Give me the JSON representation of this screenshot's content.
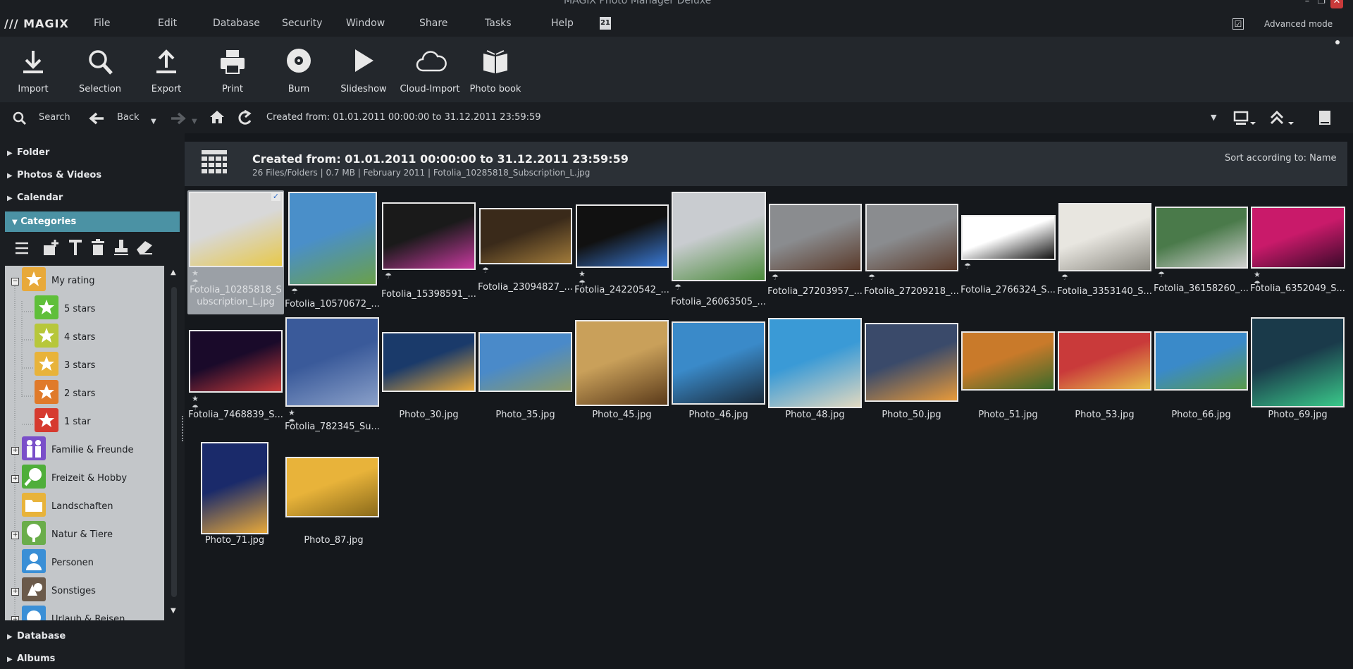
{
  "app": {
    "logo": "/// MAGIX",
    "title": "MAGIX Photo Manager Deluxe"
  },
  "menu": [
    {
      "label": "File"
    },
    {
      "label": "Edit"
    },
    {
      "label": "Database"
    },
    {
      "label": "Security"
    },
    {
      "label": "Window"
    },
    {
      "label": "Share"
    },
    {
      "label": "Tasks"
    },
    {
      "label": "Help"
    }
  ],
  "menu_badge": "21",
  "advanced_mode": {
    "label": "Advanced mode",
    "checked": true,
    "check_glyph": "☑"
  },
  "toolbar": [
    {
      "label": "Import",
      "icon": "download-icon"
    },
    {
      "label": "Selection",
      "icon": "magnifier-icon"
    },
    {
      "label": "Export",
      "icon": "upload-icon"
    },
    {
      "label": "Print",
      "icon": "printer-icon"
    },
    {
      "label": "Burn",
      "icon": "disc-icon"
    },
    {
      "label": "Slideshow",
      "icon": "play-icon"
    },
    {
      "label": "Cloud-Import",
      "icon": "cloud-icon"
    },
    {
      "label": "Photo book",
      "icon": "book-icon"
    }
  ],
  "nav": {
    "search": "Search",
    "back": "Back",
    "created_from": "Created from:  01.01.2011 00:00:00 to  31.12.2011 23:59:59"
  },
  "left": {
    "folder": "Folder",
    "photos_videos": "Photos & Videos",
    "calendar": "Calendar",
    "categories": "Categories",
    "database": "Database",
    "albums": "Albums",
    "tree": [
      {
        "label": "My rating",
        "color": "#e8a93a",
        "level": 0
      },
      {
        "label": "5 stars",
        "color": "#5fbf3a",
        "level": 1
      },
      {
        "label": "4 stars",
        "color": "#b7c73a",
        "level": 1
      },
      {
        "label": "3 stars",
        "color": "#e8b33a",
        "level": 1
      },
      {
        "label": "2 stars",
        "color": "#e07a2a",
        "level": 1
      },
      {
        "label": "1 star",
        "color": "#d63a2f",
        "level": 1
      },
      {
        "label": "Familie & Freunde",
        "color": "#7a4fc9",
        "level": 0
      },
      {
        "label": "Freizeit & Hobby",
        "color": "#4fae3a",
        "level": 0
      },
      {
        "label": "Landschaften",
        "color": "#e8b33a",
        "level": 0
      },
      {
        "label": "Natur & Tiere",
        "color": "#6aad4a",
        "level": 0
      },
      {
        "label": "Personen",
        "color": "#3a8fd6",
        "level": 0
      },
      {
        "label": "Sonstiges",
        "color": "#6b5a4a",
        "level": 0
      },
      {
        "label": "Urlaub & Reisen",
        "color": "#3a8fd6",
        "level": 0
      }
    ]
  },
  "content": {
    "title": "Created from:  01.01.2011 00:00:00 to  31.12.2011 23:59:59",
    "subtitle": "26 Files/Folders  |  0.7 MB  |  February 2011  |  Fotolia_10285818_Subscription_L.jpg",
    "sort": "Sort according to: Name",
    "thumbs": [
      {
        "caption": "Fotolia_10285818_S",
        "caption2": "ubscription_L.jpg",
        "colors": [
          "#d8d8d8",
          "#e7c84a"
        ],
        "star": true
      },
      {
        "caption": "Fotolia_10570672_...",
        "colors": [
          "#4a8fc9",
          "#6aa04a"
        ],
        "star": false
      },
      {
        "caption": "Fotolia_15398591_...",
        "colors": [
          "#1a1a1a",
          "#c93aa0"
        ],
        "star": false
      },
      {
        "caption": "Fotolia_23094827_...",
        "colors": [
          "#3a2a1a",
          "#a07a3a"
        ],
        "star": false
      },
      {
        "caption": "Fotolia_24220542_...",
        "colors": [
          "#111111",
          "#3a7ad6"
        ],
        "star": true
      },
      {
        "caption": "Fotolia_26063505_...",
        "colors": [
          "#c9ccd0",
          "#4a8a3a"
        ],
        "star": false
      },
      {
        "caption": "Fotolia_27203957_...",
        "colors": [
          "#8a8c8f",
          "#5a3a2a"
        ],
        "star": false
      },
      {
        "caption": "Fotolia_27209218_...",
        "colors": [
          "#8a8c8f",
          "#5a3a2a"
        ],
        "star": false
      },
      {
        "caption": "Fotolia_2766324_S...",
        "colors": [
          "#ffffff",
          "#111111"
        ],
        "star": false
      },
      {
        "caption": "Fotolia_3353140_S...",
        "colors": [
          "#e8e6e0",
          "#8a8880"
        ],
        "star": false
      },
      {
        "caption": "Fotolia_36158260_...",
        "colors": [
          "#4a7a4a",
          "#d0d0d0"
        ],
        "star": false
      },
      {
        "caption": "Fotolia_6352049_S...",
        "colors": [
          "#c91a6a",
          "#3a0a2a"
        ],
        "star": true
      },
      {
        "caption": "Fotolia_7468839_S...",
        "colors": [
          "#1a0a2a",
          "#c93a3a"
        ],
        "star": true
      },
      {
        "caption": "Fotolia_782345_Su...",
        "colors": [
          "#3a5a9a",
          "#8aa0c9"
        ],
        "star": true
      },
      {
        "caption": "Photo_30.jpg",
        "colors": [
          "#1a3a6a",
          "#e8a93a"
        ],
        "star": false
      },
      {
        "caption": "Photo_35.jpg",
        "colors": [
          "#4a8ac9",
          "#8a9a6a"
        ],
        "star": false
      },
      {
        "caption": "Photo_45.jpg",
        "colors": [
          "#c9a05a",
          "#5a3a1a"
        ],
        "star": false
      },
      {
        "caption": "Photo_46.jpg",
        "colors": [
          "#3a8ac9",
          "#1a2a3a"
        ],
        "star": false
      },
      {
        "caption": "Photo_48.jpg",
        "colors": [
          "#3a9ad6",
          "#e0d8c0"
        ],
        "star": false
      },
      {
        "caption": "Photo_50.jpg",
        "colors": [
          "#3a4a6a",
          "#e89a3a"
        ],
        "star": false
      },
      {
        "caption": "Photo_51.jpg",
        "colors": [
          "#c97a2a",
          "#3a6a2a"
        ],
        "star": false
      },
      {
        "caption": "Photo_53.jpg",
        "colors": [
          "#c93a3a",
          "#e8c04a"
        ],
        "star": false
      },
      {
        "caption": "Photo_66.jpg",
        "colors": [
          "#3a8ac9",
          "#5a9a4a"
        ],
        "star": false
      },
      {
        "caption": "Photo_69.jpg",
        "colors": [
          "#1a3a4a",
          "#3ac98a"
        ],
        "star": false
      },
      {
        "caption": "Photo_71.jpg",
        "colors": [
          "#1a2a6a",
          "#e8a93a"
        ],
        "star": false
      },
      {
        "caption": "Photo_87.jpg",
        "colors": [
          "#e8b33a",
          "#8a6a1a"
        ],
        "star": false
      }
    ]
  }
}
